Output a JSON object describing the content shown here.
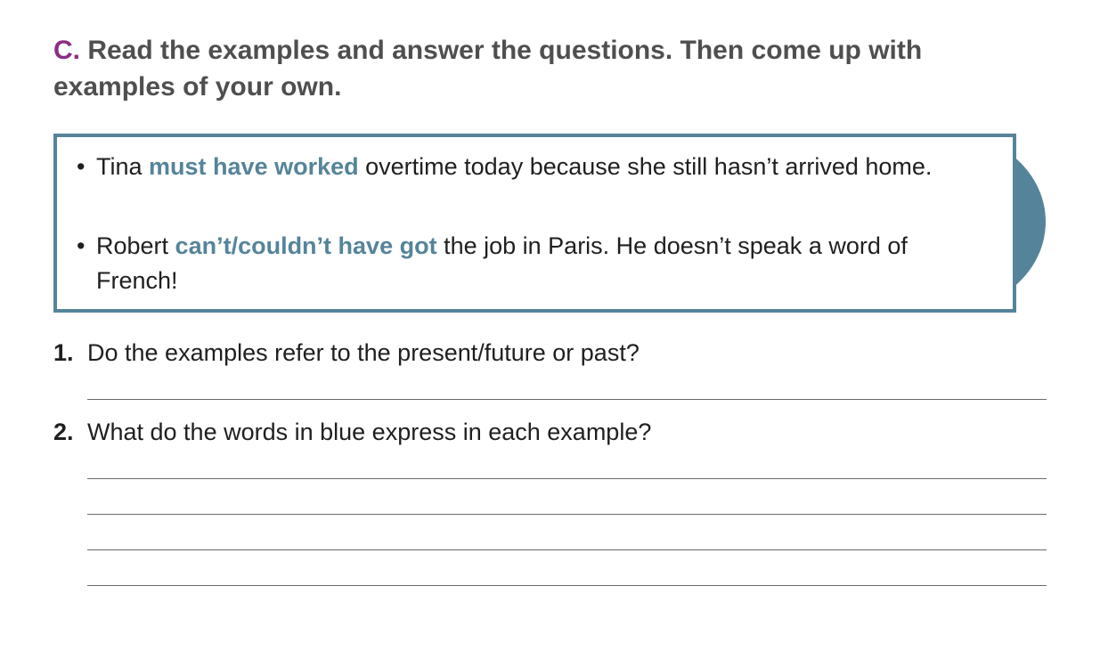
{
  "exercise": {
    "letter": "C.",
    "instruction": " Read the examples and answer the questions. Then come up with examples of your own."
  },
  "examples": [
    {
      "bullet": "•",
      "before": "Tina ",
      "highlight": "must have worked",
      "after": " overtime today because she still hasn’t arrived home."
    },
    {
      "bullet": "•",
      "before": "Robert ",
      "highlight": "can’t/couldn’t have got",
      "after": " the job in Paris. He doesn’t speak a word of French!"
    }
  ],
  "questions": [
    {
      "number": "1.",
      "text": "Do the examples refer to the present/future or past?"
    },
    {
      "number": "2.",
      "text": "What do the words in blue express in each example?"
    }
  ],
  "colors": {
    "accent_blue": "#55849a",
    "letter_purple": "#8a2d86",
    "heading_gray": "#4f4f4f"
  }
}
